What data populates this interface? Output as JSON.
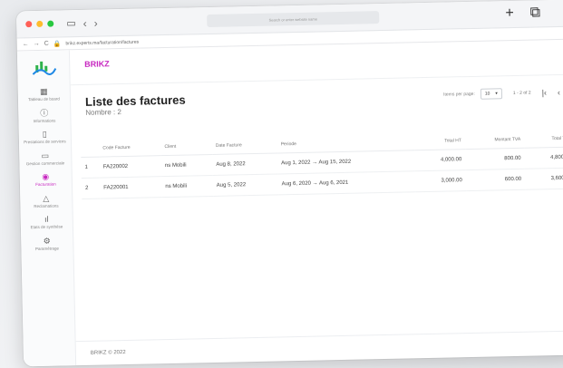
{
  "browser": {
    "address_placeholder": "Search or enter website name",
    "url": "brikz.experts.ma/facturation/factures"
  },
  "app": {
    "brand": "BRIKZ",
    "footer": "BRIKZ © 2022"
  },
  "sidebar": {
    "items": [
      {
        "label": "Tableau de board",
        "icon": "dashboard-icon"
      },
      {
        "label": "Informations",
        "icon": "info-icon"
      },
      {
        "label": "Prestations de services",
        "icon": "document-icon"
      },
      {
        "label": "Gestion commerciale",
        "icon": "folder-icon"
      },
      {
        "label": "Facturation",
        "icon": "billing-icon",
        "active": true
      },
      {
        "label": "Reclamations",
        "icon": "warning-icon"
      },
      {
        "label": "Etats de synthèse",
        "icon": "chart-icon"
      },
      {
        "label": "Paramétrage",
        "icon": "gear-icon"
      }
    ]
  },
  "page": {
    "title": "Liste des factures",
    "count": "Nombre : 2"
  },
  "pager": {
    "items_per_page_label": "Items per page:",
    "page_size": "10",
    "range": "1 - 2 of 2"
  },
  "table": {
    "headers": [
      "",
      "Code Facture",
      "Client",
      "Date Facture",
      "Periode",
      "Total HT",
      "Montant TVA",
      "Total TTC"
    ],
    "rows": [
      [
        "1",
        "FA220002",
        "ns Mobili",
        "Aug 8, 2022",
        "Aug 1, 2022 → Aug 15, 2022",
        "4,000.00",
        "800.00",
        "4,800.00"
      ],
      [
        "2",
        "FA220001",
        "ns Mobili",
        "Aug 5, 2022",
        "Aug 6, 2020 → Aug 6, 2021",
        "3,000.00",
        "600.00",
        "3,600.00"
      ]
    ]
  },
  "colors": {
    "accent": "#c727c0",
    "logo_green": "#2fb24c",
    "logo_blue": "#1e88e5"
  }
}
